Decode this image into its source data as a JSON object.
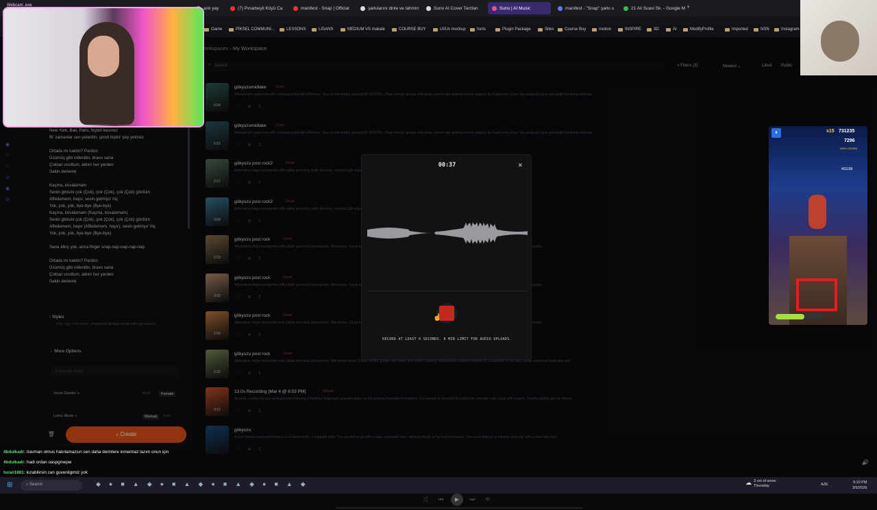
{
  "browser": {
    "tabs": [
      {
        "label": "anlı yay",
        "color": "#999"
      },
      {
        "label": "(7) Pınarbeyli Köyü Ca",
        "color": "#e33"
      },
      {
        "label": "manifest - Snap | Official",
        "color": "#e33"
      },
      {
        "label": "şarkılarını dinle ve tahmin",
        "color": "#ddd"
      },
      {
        "label": "Suno AI Cover Tarzları",
        "color": "#ddd"
      },
      {
        "label": "Suno | AI Music",
        "color": "#e3559b"
      },
      {
        "label": "manifest - \"Snap\" şarkı s",
        "color": "#5b7cff"
      },
      {
        "label": "21 Ali Suavi Sk. - Google M",
        "color": "#3cba54"
      }
    ],
    "bookmarks": [
      "Game",
      "PİKSEL COMMUNİ...",
      "LESSONS",
      "LİSANS",
      "MEDIUM VS makale",
      "COURSE BUY",
      "UI/Ux mockup",
      "fonts",
      "Plugin Package",
      "Sites",
      "Course Buy",
      "motion",
      "INSPIRE",
      "3D",
      "AI",
      "ModifyProfile",
      "Imported",
      "NSN",
      "Instagram"
    ]
  },
  "breadcrumb": {
    "parent": "Workspaces",
    "current": "My Workspace"
  },
  "toolbar": {
    "search_placeholder": "Search",
    "filters": "Filters (3)",
    "sort": "Newest",
    "liked": "Liked",
    "public": "Public"
  },
  "webcam": {
    "label": "Webcam .exe"
  },
  "lyrics": "New York, Bali, Paris, hiçbiri kesmez\nBi' zamanlar sen yeterdin, şimdi hiçbir' şey yetmez\n\nOrtada mı kaldın? Pardon\nÜzümüş gibi rollendin, bravo sana\nÇoktan unuttum, aldım her yerden\nSakin deneme\n\nKaçma, kovalamam\nSenin gibisini çok (Çok), çok (Çok), çok (Çok) gördüm\nAffedemem, hayır, sesin gelmiyo' hiç\nYok, yok, yok, bye-bye (Bye-bye)\nKaçma, kovalamam (Kaçma, kovalamam)\nSenin gibisini çok (Çok), çok (Çok), çok (Çok) gördüm\nAffedemem, hayır (Affedemem, hayır), sesin gelmiyo' hiç\nYok, yok, yok, bye-bye (Bye-bye)\n\nSana alkış yok, anca finger snap-nap-nap-nap-nap\n\nOrtada mı kaldın? Pardon\nÜzümüş gibi rollendin, bravo sana\nÇoktan unuttum, aldım her yerden\nSakin deneme",
  "left_panel": {
    "styles_label": "Styles",
    "styles_value": "trap, rap rock cover, emotional female vocal with rap verses",
    "more_options": "More Options",
    "exclude_placeholder": "Exclude styles",
    "vocal_gender_label": "Vocal Gender",
    "vocal_male": "Male",
    "vocal_female": "Female",
    "lyrics_mode_label": "Lyrics Mode",
    "lyrics_manual": "Manual",
    "lyrics_auto": "Auto",
    "create_button": "Create"
  },
  "songs": [
    {
      "title": "gökyuzumidlake",
      "badge": "Cover",
      "duration": "5:04",
      "desc": "Atmospheric post-rock with cinematic indie folk influence. Slow to mid-tempo (around 85-90 BPM). Clean electric guitars with delay, reverb and ambient swells inspired by Explosions in the Sky gradually layer and build emotional intensity.",
      "thumb": "#2d5a52"
    },
    {
      "title": "gökyuzumidlake",
      "badge": "Cover",
      "duration": "5:01",
      "desc": "Atmospheric post-rock with cinematic indie folk influence. Slow to mid-tempo (around 85-90 BPM). Clean electric guitars with delay, reverb and ambient swells inspired by Explosions in the Sky gradually layer and build emotional intensity.",
      "thumb": "#2b5560"
    },
    {
      "title": "gökyuzu post rock2",
      "badge": "Cover",
      "duration": "3:07",
      "desc": "Alternative singer-songwriter with subtle post-rock build structure, around Light organic drums and warm bass slowly enter. Clean electric guitars with delay and reverb gradually layer and expand.",
      "thumb": "#55705a"
    },
    {
      "title": "gökyuzu post rock2",
      "badge": "Cover",
      "duration": "3:09",
      "desc": "Alternative singer-songwriter with subtle post-rock build structure, around Light organic drums and warm bass slowly enter. Clean electric guitars with delay and reverb gradually layer and expand.",
      "thumb": "#3d7a9a"
    },
    {
      "title": "gökyuzu post rock",
      "badge": "Cover",
      "duration": "2:53",
      "desc": "Alternative singer-songwriter with subtle post-rock atmosphere. Mid-tempo. Clean electric guitars with delay and reverb creating atmospheric textures inspired by Explosions in the Sky. Gentle progression.",
      "thumb": "#8a7050"
    },
    {
      "title": "gökyuzu post rock",
      "badge": "Cover",
      "duration": "3:03",
      "desc": "Alternative singer-songwriter with subtle post-rock atmosphere. Mid-tempo. Clean electric guitars with delay and reverb creating atmospheric textures inspired by Explosions in the Sky. Gentle progression.",
      "thumb": "#b59070"
    },
    {
      "title": "gökyuzu post rock",
      "badge": "Cover",
      "duration": "2:59",
      "desc": "Alternative singer-songwriter with subtle post-rock atmosphere. Mid-tempo. Clean electric guitars with delay and reverb creating atmospheric textures inspired by Explosions in the Sky. Gentle progression.",
      "thumb": "#c07a40"
    },
    {
      "title": "gökyuzu post rock",
      "badge": "Cover",
      "duration": "2:33",
      "desc": "Alternative singer-songwriter with subtle post-rock atmosphere. Mid-tempo piano. Clean electric guitars with delay and reverb creating atmospheric textures inspired by Explosions in the Sky. Gentle emotional build with soft.",
      "thumb": "#7a8a5a"
    },
    {
      "title": "13.0s Recording (Mar 4 @ 8:59 PM)",
      "badge": "Upload",
      "duration": "0:12",
      "desc": "Acoustic soulful folk-pop arrangement featuring a rhythmic fingerstyle acoustic guitar as the primary harmonic foundation. The melody is hummed by a delicate, intimate male vocal with a warm, breathy quality and no vibrato.",
      "thumb": "#c8502a"
    },
    {
      "title": "gökyuzu",
      "badge": "",
      "duration": "",
      "desc": "A solo female vocal performance in a melancholic, a cappella style. The vocalist sings with a clear, sustained tone, utilizing vibrato at the end of phrases. The vocal delivery is intimate and raw, with a minor-key feel.",
      "thumb": "#1a4a7a"
    }
  ],
  "modal": {
    "timer": "00:37",
    "hint": "RECORD AT LEAST 6 SECONDS. 8 MIN LIMIT FOR AUDIO UPLOADS."
  },
  "game": {
    "multiplier": "x15",
    "score": "731235",
    "coins": "7296",
    "high_score_label": "HIGH SCORE",
    "high_score": "401198"
  },
  "chat": [
    {
      "user": "4bdulkadr:",
      "text": "travman olmus hatırlamazsın sen daha derinlere inmemiaz lazım onun için"
    },
    {
      "user": "4bdulkadr:",
      "text": "hadi ordan oaspgmepw"
    },
    {
      "user": "turan1881:",
      "text": "kızabilirsin can guvenligimiz yok"
    }
  ],
  "taskbar": {
    "search": "Search",
    "weather": "3 cm of snow",
    "weather_day": "Thursday",
    "lang": "AZE",
    "time": "9:10 PM",
    "date": "3/5/2026"
  }
}
